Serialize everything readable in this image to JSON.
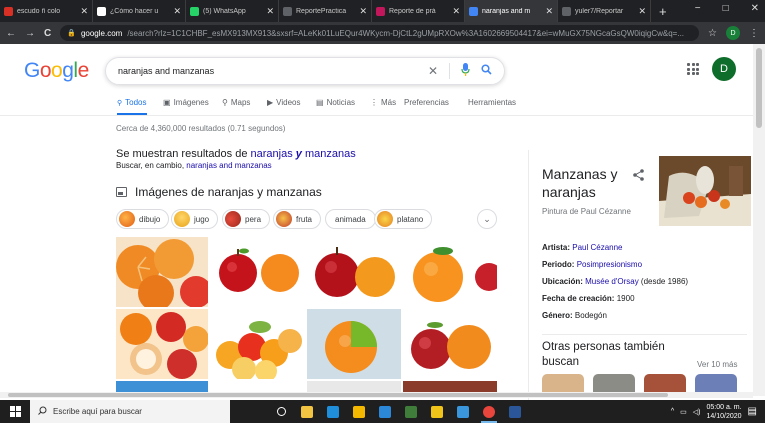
{
  "browser": {
    "tabs": [
      {
        "title": "escudo ñ colo",
        "color": "#d93025",
        "active": false
      },
      {
        "title": "¿Cómo hacer u",
        "color": "#ffffff",
        "active": false
      },
      {
        "title": "(5) WhatsApp",
        "color": "#25d366",
        "active": false
      },
      {
        "title": "ReportePractica",
        "color": "#5f6368",
        "active": false
      },
      {
        "title": "Reporte de prá",
        "color": "#c2185b",
        "active": false
      },
      {
        "title": "naranjas and m",
        "color": "#4285f4",
        "active": true
      },
      {
        "title": "yuler7/Reportar",
        "color": "#5f6368",
        "active": false
      }
    ],
    "new_tab": "+",
    "window_controls": {
      "minimize": "−",
      "maximize": "□",
      "close": "✕"
    },
    "url_host": "google.com",
    "url_path": "/search?rlz=1C1CHBF_esMX913MX913&sxsrf=ALeKk01LuEQur4WKycm-DjCtL2gUMpRXOw%3A1602669504417&ei=wMuGX75NGcaGsQW0iqigCw&q=...",
    "back": "←",
    "forward": "→",
    "reload": "C",
    "star": "☆",
    "profile_initial": "D",
    "menu": "⋮"
  },
  "google": {
    "logo": [
      "G",
      "o",
      "o",
      "g",
      "l",
      "e"
    ],
    "query": "naranjas and manzanas",
    "clear": "✕",
    "profile_initial": "D"
  },
  "nav": {
    "tabs": [
      {
        "label": "Todos",
        "icon": "🔍",
        "active": true
      },
      {
        "label": "Imágenes",
        "icon": "▣",
        "active": false
      },
      {
        "label": "Maps",
        "icon": "⚲",
        "active": false
      },
      {
        "label": "Videos",
        "icon": "▶",
        "active": false
      },
      {
        "label": "Noticias",
        "icon": "▤",
        "active": false
      },
      {
        "label": "Más",
        "icon": "⋮",
        "active": false
      },
      {
        "label": "Preferencias",
        "icon": "",
        "active": false
      },
      {
        "label": "Herramientas",
        "icon": "",
        "active": false
      }
    ]
  },
  "results": {
    "stats": "Cerca de 4,360,000 resultados (0.71 segundos)",
    "spell_prefix": "Se muestran resultados de ",
    "spell_word1": "naranjas ",
    "spell_word2": "y",
    "spell_word3": " manzanas",
    "spell_alt_prefix": "Buscar, en cambio, ",
    "spell_alt_link": "naranjas and manzanas",
    "images_heading": "Imágenes de naranjas y manzanas",
    "chips": [
      {
        "label": "dibujo",
        "color": "#f29a3a"
      },
      {
        "label": "jugo",
        "color": "#f7b731"
      },
      {
        "label": "pera",
        "color": "#c0392b"
      },
      {
        "label": "fruta",
        "color": "#e67e22"
      },
      {
        "label": "animada",
        "color": ""
      },
      {
        "label": "platano",
        "color": "#f1c40f"
      }
    ],
    "chips_more": "⌄"
  },
  "knowledge_panel": {
    "title": "Manzanas y naranjas",
    "share": "<",
    "subtitle": "Pintura de Paul Cézanne",
    "facts": [
      {
        "label": "Artista:",
        "value": "Paul Cézanne",
        "link": true,
        "extra": ""
      },
      {
        "label": "Periodo:",
        "value": "Posimpresionismo",
        "link": true,
        "extra": ""
      },
      {
        "label": "Ubicación:",
        "value": "Musée d'Orsay",
        "link": true,
        "extra": " (desde 1986)"
      },
      {
        "label": "Fecha de creación:",
        "value": "1900",
        "link": false,
        "extra": ""
      },
      {
        "label": "Género:",
        "value": "Bodegón",
        "link": false,
        "extra": ""
      }
    ],
    "people_also": "Otras personas también buscan",
    "see_more": "Ver 10 más"
  },
  "taskbar": {
    "search_placeholder": "Escribe aquí para buscar",
    "time": "05:00 a. m.",
    "date": "14/10/2020",
    "apps": [
      {
        "name": "task-view",
        "color": "#ffffff"
      },
      {
        "name": "file-explorer",
        "color": "#f3c442"
      },
      {
        "name": "edge",
        "color": "#1f8fdc"
      },
      {
        "name": "explorer",
        "color": "#f5b800"
      },
      {
        "name": "mail",
        "color": "#2b88d8"
      },
      {
        "name": "python",
        "color": "#3f7e3a"
      },
      {
        "name": "sticky",
        "color": "#f0c419"
      },
      {
        "name": "vscode",
        "color": "#3a96dd"
      },
      {
        "name": "chrome",
        "color": "#e8453c"
      },
      {
        "name": "word",
        "color": "#2b579a"
      }
    ]
  }
}
